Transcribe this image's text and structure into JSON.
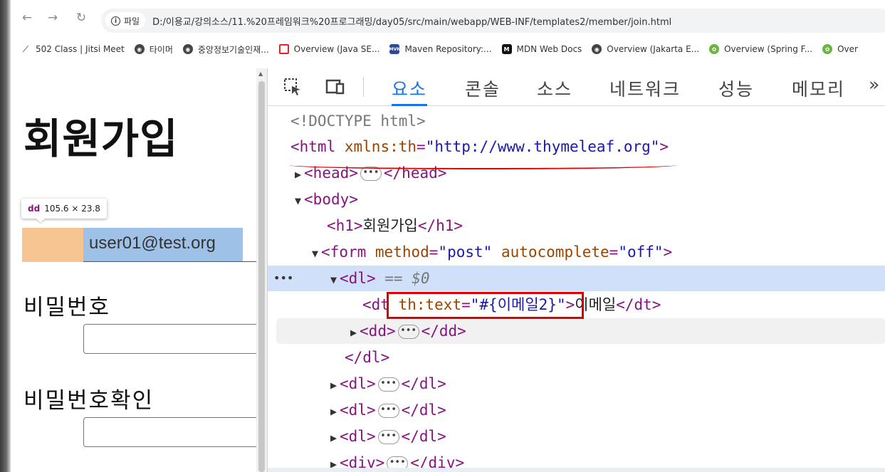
{
  "browser": {
    "site_info_label": "파일",
    "url": "D:/이용교/강의소스/11.%20프레임워크%20프로그래밍/day05/src/main/webapp/WEB-INF/templates2/member/join.html",
    "bookmarks": [
      {
        "label": "502 Class | Jitsi Meet",
        "icon": "jitsi-icon"
      },
      {
        "label": "타이머",
        "icon": "globe-icon"
      },
      {
        "label": "중앙정보기술인재...",
        "icon": "globe-icon"
      },
      {
        "label": "Overview (Java SE...",
        "icon": "oracle-icon"
      },
      {
        "label": "Maven Repository:...",
        "icon": "maven-icon"
      },
      {
        "label": "MDN Web Docs",
        "icon": "mdn-icon"
      },
      {
        "label": "Overview (Jakarta E...",
        "icon": "globe-icon"
      },
      {
        "label": "Overview (Spring F...",
        "icon": "spring-icon"
      },
      {
        "label": "Over",
        "icon": "spring-icon"
      }
    ]
  },
  "page": {
    "title": "회원가입",
    "tooltip_tag": "dd",
    "tooltip_size": "105.6 × 23.8",
    "email_value": "user01@test.org",
    "password_label": "비밀번호",
    "password_confirm_label": "비밀번호확인"
  },
  "devtools": {
    "tabs": [
      "요소",
      "콘솔",
      "소스",
      "네트워크",
      "성능",
      "메모리"
    ],
    "more": "»",
    "lines": {
      "doctype": "<!DOCTYPE html>",
      "html_open": "<html",
      "html_attr": "xmlns:th",
      "html_val": "\"http://www.thymeleaf.org\"",
      "head_open": "<head>",
      "head_close": "</head>",
      "body_open": "<body>",
      "h1_open": "<h1>",
      "h1_text": "회원가입",
      "h1_close": "</h1>",
      "form_open": "<form",
      "form_attr1": "method",
      "form_val1": "\"post\"",
      "form_attr2": "autocomplete",
      "form_val2": "\"off\"",
      "dl_open": "<dl>",
      "dl_marker": "== $0",
      "dt_open": "<dt",
      "dt_attr": "th:text",
      "dt_val": "\"#{이메일2}\"",
      "dt_text": "이메일",
      "dt_close": "</dt>",
      "dd_open": "<dd>",
      "dd_close": "</dd>",
      "dl_close": "</dl>",
      "div_open": "<div>",
      "div_close": "</div>",
      "ellipsis": "•••",
      "row_dots": "•••"
    }
  },
  "colors": {
    "accent": "#1a73e8",
    "tag": "#881280",
    "attr": "#994500",
    "value": "#1a1aa6",
    "annotation_red": "#e00000",
    "margin_highlight": "#f6c48e",
    "content_highlight": "#9fc1e8"
  }
}
